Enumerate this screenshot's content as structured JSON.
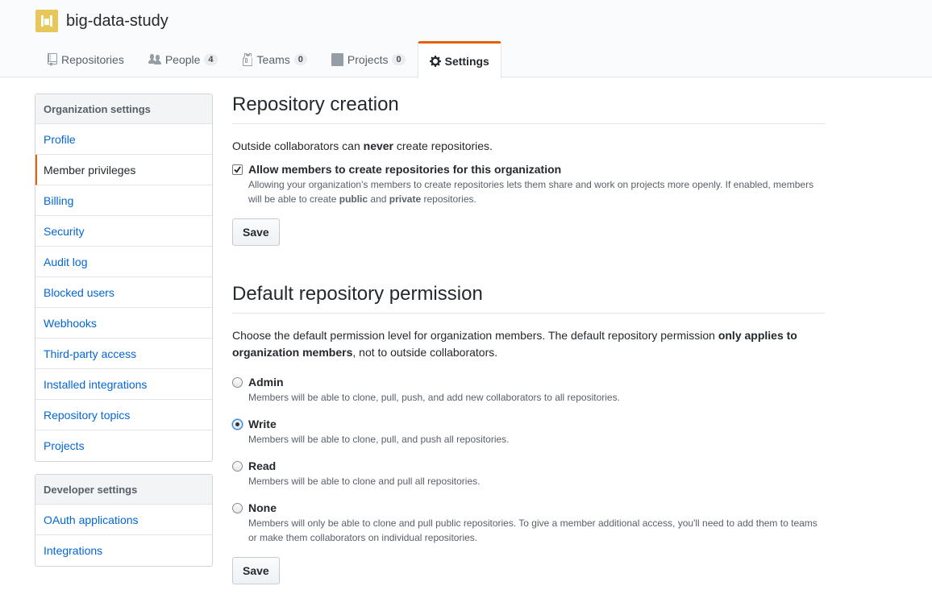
{
  "org": {
    "name": "big-data-study"
  },
  "tabs": [
    {
      "label": "Repositories",
      "count": null,
      "icon": "repo-icon"
    },
    {
      "label": "People",
      "count": "4",
      "icon": "people-icon"
    },
    {
      "label": "Teams",
      "count": "0",
      "icon": "jersey-icon"
    },
    {
      "label": "Projects",
      "count": "0",
      "icon": "project-icon"
    },
    {
      "label": "Settings",
      "count": null,
      "icon": "gear-icon",
      "selected": true
    }
  ],
  "sidebar": {
    "org_heading": "Organization settings",
    "org_items": [
      "Profile",
      "Member privileges",
      "Billing",
      "Security",
      "Audit log",
      "Blocked users",
      "Webhooks",
      "Third-party access",
      "Installed integrations",
      "Repository topics",
      "Projects"
    ],
    "dev_heading": "Developer settings",
    "dev_items": [
      "OAuth applications",
      "Integrations"
    ]
  },
  "repo_creation": {
    "title": "Repository creation",
    "intro_pre": "Outside collaborators can ",
    "intro_bold": "never",
    "intro_post": " create repositories.",
    "checkbox_label": "Allow members to create repositories for this organization",
    "checkbox_checked": true,
    "note_pre": "Allowing your organization's members to create repositories lets them share and work on projects more openly. If enabled, members will be able to create ",
    "note_public": "public",
    "note_and": " and ",
    "note_private": "private",
    "note_post": " repositories.",
    "save_label": "Save"
  },
  "default_permission": {
    "title": "Default repository permission",
    "intro_pre": "Choose the default permission level for organization members. The default repository permission ",
    "intro_bold": "only applies to organization members",
    "intro_post": ", not to outside collaborators.",
    "options": [
      {
        "label": "Admin",
        "note": "Members will be able to clone, pull, push, and add new collaborators to all repositories.",
        "checked": false
      },
      {
        "label": "Write",
        "note": "Members will be able to clone, pull, and push all repositories.",
        "checked": true
      },
      {
        "label": "Read",
        "note": "Members will be able to clone and pull all repositories.",
        "checked": false
      },
      {
        "label": "None",
        "note": "Members will only be able to clone and pull public repositories. To give a member additional access, you'll need to add them to teams or make them collaborators on individual repositories.",
        "checked": false
      }
    ],
    "save_label": "Save"
  },
  "colors": {
    "accent_orange": "#e36209",
    "link_blue": "#0366d6",
    "avatar_yellow": "#e7c75a"
  }
}
